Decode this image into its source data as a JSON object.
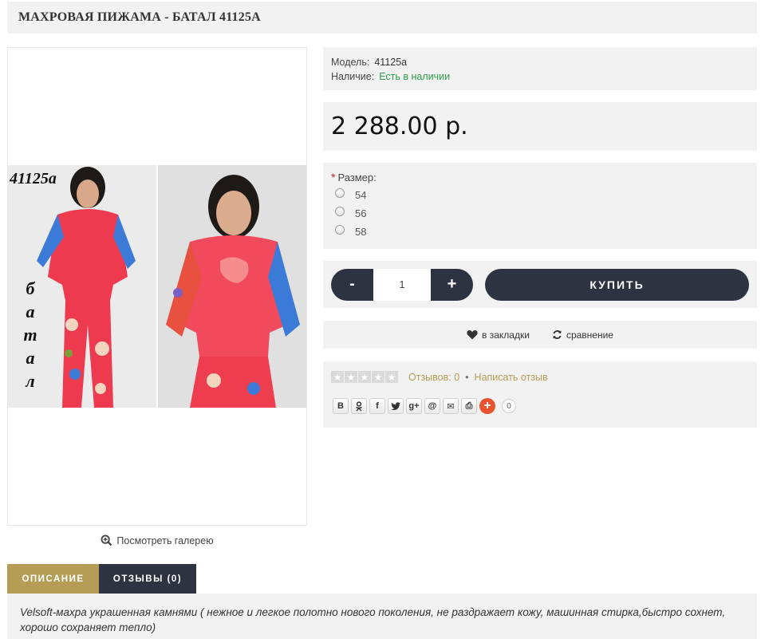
{
  "product": {
    "title": "МАХРОВАЯ ПИЖАМА - БАТАЛ 41125А",
    "photo_tag": "41125а",
    "vertical_word": [
      "б",
      "а",
      "т",
      "а",
      "л"
    ],
    "gallery_link": "Посмотреть галерею"
  },
  "info": {
    "model_label": "Модель:",
    "model_value": "41125a",
    "stock_label": "Наличие:",
    "stock_value": "Есть в наличии",
    "stock_color": "#2e9c4c"
  },
  "price": "2 288.00 р.",
  "options": {
    "label": "Размер:",
    "required_mark": "*",
    "sizes": [
      "54",
      "56",
      "58"
    ]
  },
  "cart": {
    "minus": "-",
    "quantity": "1",
    "plus": "+",
    "buy_label": "КУПИТЬ"
  },
  "actions": {
    "wishlist": "в закладки",
    "compare": "сравнение"
  },
  "reviews": {
    "rating": 0,
    "count_label": "Отзывов: 0",
    "separator": "•",
    "write_label": "Написать отзыв"
  },
  "share": {
    "icons": [
      "vk-icon",
      "odnoklassniki-icon",
      "facebook-icon",
      "twitter-icon",
      "google-plus-icon",
      "mail-ru-icon",
      "email-icon",
      "print-icon",
      "more-share-icon"
    ],
    "glyphs": [
      "B",
      "ok",
      "f",
      "t",
      "g+",
      "@",
      "✉",
      "⎙",
      "+"
    ],
    "count": "0"
  },
  "tabs": {
    "description": "ОПИСАНИЕ",
    "reviews": "ОТЗЫВЫ (0)"
  },
  "description": "Velsoft-махра украшенная камнями ( нежное и легкое полотно нового поколения, не раздражает кожу, машинная стирка,быстро сохнет, хорошо сохраняет тепло)",
  "colors": {
    "accent_gold": "#b59d55",
    "dark_navy": "#2e3342",
    "panel_bg": "#f2f2f2"
  }
}
